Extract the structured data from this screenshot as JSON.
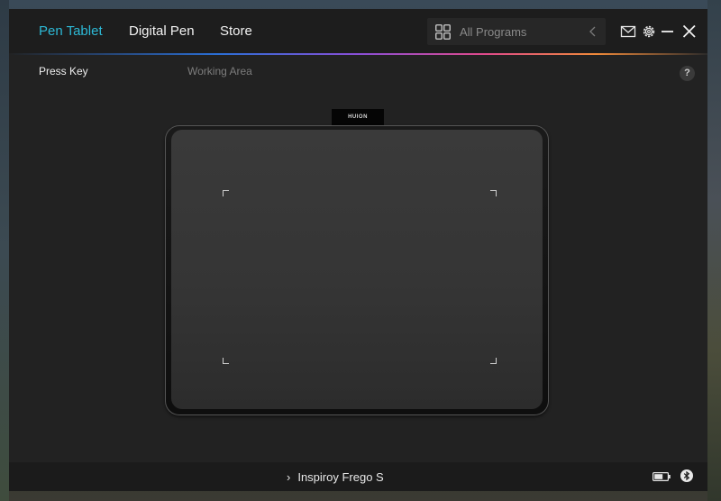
{
  "header": {
    "tabs": [
      {
        "label": "Pen Tablet",
        "active": true
      },
      {
        "label": "Digital Pen",
        "active": false
      },
      {
        "label": "Store",
        "active": false
      }
    ],
    "search": {
      "placeholder": "All Programs",
      "icon": "grid-icon"
    },
    "window_controls": [
      "mail-icon",
      "gear-icon",
      "minimize-icon",
      "close-icon"
    ]
  },
  "subnav": {
    "items": [
      {
        "label": "Press Key",
        "active": true
      },
      {
        "label": "Working Area",
        "active": false
      }
    ],
    "help": "?"
  },
  "tablet": {
    "brand": "HUION"
  },
  "footer": {
    "device_name": "Inspiroy Frego S",
    "battery_icon": "battery-icon",
    "bluetooth_icon": "bluetooth-icon"
  },
  "colors": {
    "accent": "#2db9d6",
    "background": "#222222",
    "led": "#5df06a"
  }
}
